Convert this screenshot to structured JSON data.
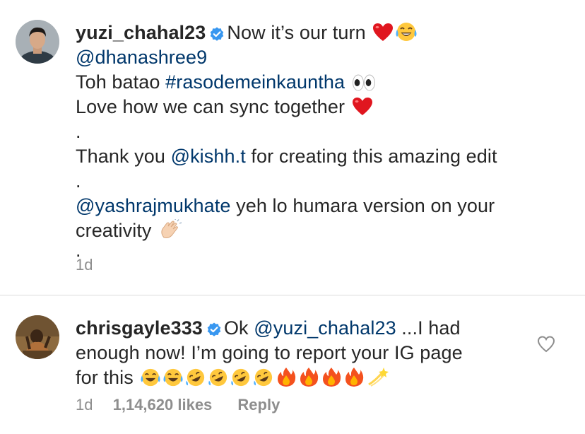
{
  "post_caption": {
    "username": "yuzi_chahal23",
    "line1_text": "Now it’s our turn",
    "line2_mention": "@dhanashree9",
    "line3_text": "Toh batao ",
    "line3_hashtag": "#rasodemeinkauntha",
    "line4_text": "Love how we can sync together",
    "dot1": ".",
    "line5_text_before": "Thank you ",
    "line5_mention": "@kishh.t",
    "line5_text_after": " for creating this amazing edit",
    "dot2": ".",
    "line6_mention": "@yashrajmukhate",
    "line6_text": " yeh lo humara version on your",
    "line7_text": "creativity",
    "dot3": ".",
    "timestamp": "1d"
  },
  "comment": {
    "username": "chrisgayle333",
    "line1_text_before": "Ok ",
    "line1_mention": "@yuzi_chahal23",
    "line1_text_after": " ...I had",
    "line2_text": "enough now! I’m going to report your IG page",
    "line3_text": "for this",
    "timestamp": "1d",
    "likes": "1,14,620 likes",
    "reply_label": "Reply"
  },
  "colors": {
    "text": "#262626",
    "link": "#00376b",
    "meta": "#8e8e8e",
    "verified": "#3897f0",
    "divider": "#dbdbdb"
  },
  "icons": {
    "verified": "verified-badge-icon",
    "heart_outline": "heart-outline-icon",
    "emojis": [
      "red-heart",
      "tears-of-joy",
      "eyes",
      "clapping-hands",
      "rolling-laughing",
      "fire",
      "dizzy"
    ]
  }
}
